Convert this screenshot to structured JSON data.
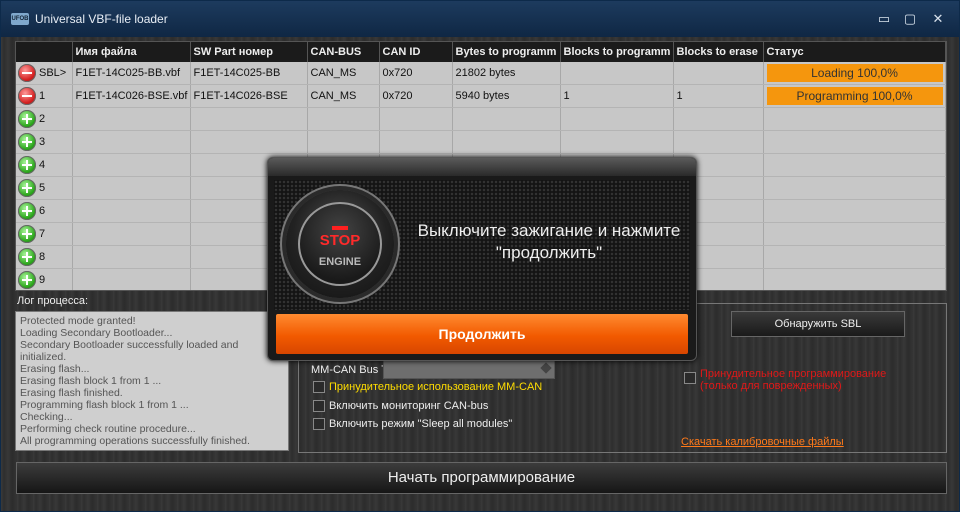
{
  "titlebar": {
    "icon_text": "UFOB",
    "title": "Universal VBF-file loader",
    "min": "▭",
    "restore": "▢",
    "close": "✕"
  },
  "table": {
    "columns": [
      "",
      "Имя файла",
      "SW Part номер",
      "CAN-BUS",
      "CAN ID",
      "Bytes to programm",
      "Blocks to programm",
      "Blocks to erase",
      "Статус"
    ],
    "rows": [
      {
        "btn": "minus",
        "name": "SBL>",
        "file": "F1ET-14C025-BB.vbf",
        "sw": "F1ET-14C025-BB",
        "bus": "CAN_MS",
        "id": "0x720",
        "bytes": "21802 bytes",
        "blocks": "",
        "erase": "",
        "status": "Loading 100,0%"
      },
      {
        "btn": "minus",
        "name": "1",
        "file": "F1ET-14C026-BSE.vbf",
        "sw": "F1ET-14C026-BSE",
        "bus": "CAN_MS",
        "id": "0x720",
        "bytes": "5940 bytes",
        "blocks": "1",
        "erase": "1",
        "status": "Programming 100,0%"
      },
      {
        "btn": "plus",
        "name": "2"
      },
      {
        "btn": "plus",
        "name": "3"
      },
      {
        "btn": "plus",
        "name": "4"
      },
      {
        "btn": "plus",
        "name": "5"
      },
      {
        "btn": "plus",
        "name": "6"
      },
      {
        "btn": "plus",
        "name": "7"
      },
      {
        "btn": "plus",
        "name": "8"
      },
      {
        "btn": "plus",
        "name": "9"
      }
    ]
  },
  "log": {
    "label": "Лог процесса:",
    "lines": [
      "Protected mode granted!",
      "Loading Secondary Bootloader...",
      "Secondary Bootloader successfully loaded and initialized.",
      "Erasing flash...",
      "Erasing flash block 1 from 1 ...",
      "Erasing flash finished.",
      "Programming flash block 1 from 1 ...",
      "Checking...",
      "Performing check routine procedure...",
      "All programming operations successfully finished."
    ]
  },
  "options": {
    "detect_sbl": "Обнаружить SBL",
    "bus_label": "MM-CAN Bus Тип:",
    "force_mmcan": "Принудительное использование MM-CAN",
    "monitor_can": "Включить мониторинг CAN-bus",
    "sleep_mode": "Включить режим \"Sleep all modules\"",
    "force_prog_line1": "Принудительное программирование",
    "force_prog_line2": "(только для поврежденных)",
    "download_link": "Скачать калибровочные файлы"
  },
  "start_button": "Начать программирование",
  "modal": {
    "stop": "STOP",
    "engine": "ENGINE",
    "message_line1": "Выключите зажигание и нажмите",
    "message_line2": "\"продолжить\"",
    "continue": "Продолжить"
  },
  "colors": {
    "status_fill": "#f5960d",
    "continue_button": "#f25a00",
    "force_prog_text": "#e01818",
    "yellow_option": "#ffdd00"
  }
}
